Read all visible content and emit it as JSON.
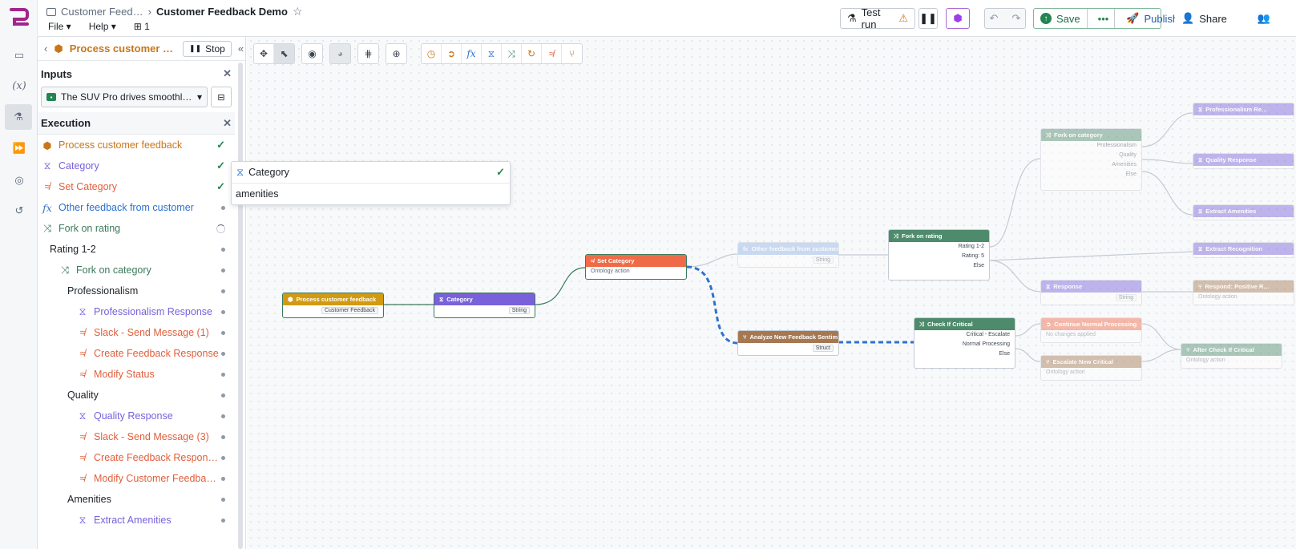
{
  "topbar": {
    "breadcrumb_parent": "Customer Feed…",
    "breadcrumb_current": "Customer Feedback Demo",
    "menu": [
      "File",
      "Help"
    ],
    "branch_count": "1",
    "test_run": "Test run",
    "save": "Save",
    "publish": "Publish",
    "share": "Share"
  },
  "panel": {
    "title": "Process customer …",
    "stop": "Stop",
    "inputs_label": "Inputs",
    "input_value": "The SUV Pro drives smoothl…",
    "execution_label": "Execution",
    "items": [
      {
        "label": "Process customer feedback",
        "indent": 0,
        "color": "#c87619",
        "icon": "block-icon",
        "status": "done"
      },
      {
        "label": "Category",
        "indent": 0,
        "color": "#7961db",
        "icon": "llm-icon",
        "status": "done"
      },
      {
        "label": "Set Category",
        "indent": 0,
        "color": "#e05f3c",
        "icon": "action-icon",
        "status": "done"
      },
      {
        "label": "Other feedback from customer",
        "indent": 0,
        "color": "#2d72d2",
        "icon": "function-icon",
        "status": "pending"
      },
      {
        "label": "Fork on rating",
        "indent": 0,
        "color": "#3b7a5c",
        "icon": "fork-icon",
        "status": "running"
      },
      {
        "label": "Rating 1-2",
        "indent": 1,
        "color": "#1c2127",
        "icon": "",
        "status": "pending"
      },
      {
        "label": "Fork on category",
        "indent": 2,
        "color": "#3b7a5c",
        "icon": "fork-icon",
        "status": "pending"
      },
      {
        "label": "Professionalism",
        "indent": 3,
        "color": "#1c2127",
        "icon": "",
        "status": "pending"
      },
      {
        "label": "Professionalism Response",
        "indent": 4,
        "color": "#7961db",
        "icon": "llm-icon",
        "status": "pending"
      },
      {
        "label": "Slack - Send Message (1)",
        "indent": 4,
        "color": "#e05f3c",
        "icon": "action-icon",
        "status": "pending"
      },
      {
        "label": "Create Feedback Response",
        "indent": 4,
        "color": "#e05f3c",
        "icon": "action-icon",
        "status": "pending"
      },
      {
        "label": "Modify Status",
        "indent": 4,
        "color": "#e05f3c",
        "icon": "action-icon",
        "status": "pending"
      },
      {
        "label": "Quality",
        "indent": 3,
        "color": "#1c2127",
        "icon": "",
        "status": "pending"
      },
      {
        "label": "Quality Response",
        "indent": 4,
        "color": "#7961db",
        "icon": "llm-icon",
        "status": "pending"
      },
      {
        "label": "Slack - Send Message (3)",
        "indent": 4,
        "color": "#e05f3c",
        "icon": "action-icon",
        "status": "pending"
      },
      {
        "label": "Create Feedback Respons…",
        "indent": 4,
        "color": "#e05f3c",
        "icon": "action-icon",
        "status": "pending"
      },
      {
        "label": "Modify Customer Feedbac…",
        "indent": 4,
        "color": "#e05f3c",
        "icon": "action-icon",
        "status": "pending"
      },
      {
        "label": "Amenities",
        "indent": 3,
        "color": "#1c2127",
        "icon": "",
        "status": "pending"
      },
      {
        "label": "Extract Amenities",
        "indent": 4,
        "color": "#7961db",
        "icon": "llm-icon",
        "status": "pending"
      }
    ]
  },
  "popup": {
    "title": "Category",
    "value": "amenities"
  },
  "nodes": {
    "n1": {
      "title": "Process customer feedback",
      "tag": "Customer Feedback",
      "color": "#d19a12"
    },
    "n2": {
      "title": "Category",
      "tag": "String",
      "color": "#7961db"
    },
    "n3": {
      "title": "Set Category",
      "sub": "Ontology action",
      "color": "#ef6b48"
    },
    "n4": {
      "title": "Other feedback from customer",
      "tag": "String",
      "color": "#8fb3e8"
    },
    "n5": {
      "title": "Fork on rating",
      "outs": [
        "Rating 1-2",
        "Rating: 5",
        "Else"
      ],
      "color": "#4e8a6c"
    },
    "n6": {
      "title": "Analyze New Feedback Sentim…",
      "tag": "Struct",
      "color": "#a57852"
    },
    "n7": {
      "title": "Check If Critical",
      "outs": [
        "Critical - Escalate",
        "Normal Processing",
        "Else"
      ],
      "color": "#4e8a6c"
    },
    "n8": {
      "title": "Fork on category",
      "outs": [
        "Professionalism",
        "Quality",
        "Amenities",
        "Else"
      ],
      "color": "#4e8a6c"
    },
    "n9": {
      "title": "Response",
      "tag": "String",
      "color": "#7961db"
    },
    "n10": {
      "title": "Continue Normal Processing",
      "sub": "No changes applied",
      "color": "#ef6b48"
    },
    "n11": {
      "title": "Escalate New Critical",
      "sub": "Ontology action",
      "color": "#a57852"
    },
    "n12": {
      "title": "Professionalism Re…",
      "color": "#7961db"
    },
    "n13": {
      "title": "Quality Response",
      "color": "#7961db"
    },
    "n14": {
      "title": "Extract Amenities",
      "color": "#7961db"
    },
    "n15": {
      "title": "Extract Recognition",
      "color": "#7961db"
    },
    "n16": {
      "title": "Respond: Positive R…",
      "sub": "Ontology action",
      "color": "#a57852"
    },
    "n17": {
      "title": "After Check If Critical",
      "sub": "Ontology action",
      "color": "#4e8a6c"
    }
  },
  "colors": {
    "accent": "#2d72d2",
    "success": "#238551",
    "warning": "#c87619",
    "ontology": "#e05f3c",
    "llm": "#7961db"
  }
}
